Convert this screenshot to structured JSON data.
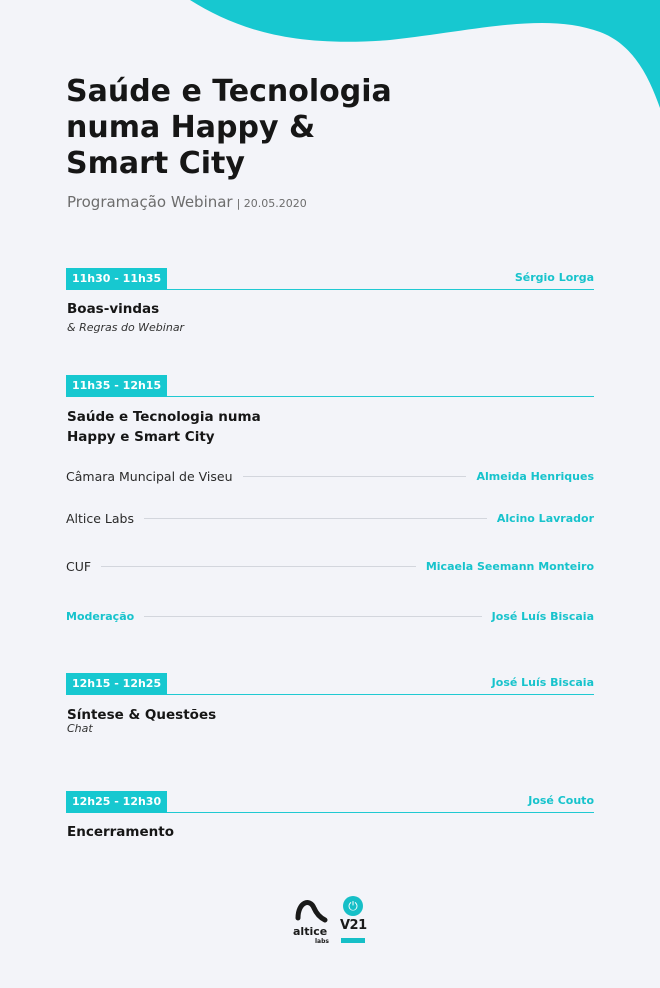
{
  "header": {
    "title_lines": [
      "Saúde e Tecnologia",
      "numa Happy &",
      "Smart City"
    ],
    "subtitle": "Programação Webinar",
    "date": "| 20.05.2020"
  },
  "sessions": [
    {
      "time": "11h30 - 11h35",
      "speaker": "Sérgio Lorga",
      "title_lines": [
        "Boas-vindas"
      ],
      "subtitle": "& Regras do Webinar"
    },
    {
      "time": "11h35 - 12h15",
      "title_lines": [
        "Saúde e Tecnologia numa",
        "Happy e Smart City"
      ],
      "participants": [
        {
          "org": "Câmara Muncipal de Viseu",
          "name": "Almeida Henriques"
        },
        {
          "org": "Altice Labs",
          "name": "Alcino Lavrador"
        },
        {
          "org": "CUF",
          "name": "Micaela Seemann Monteiro"
        },
        {
          "org": "Moderação",
          "name": "José Luís Biscaia"
        }
      ]
    },
    {
      "time": "12h15 - 12h25",
      "speaker": "José Luís Biscaia",
      "title_lines": [
        "Síntese & Questões"
      ],
      "subtitle": "Chat"
    },
    {
      "time": "12h25 - 12h30",
      "speaker": "José Couto",
      "title_lines": [
        "Encerramento"
      ]
    }
  ],
  "logos": {
    "altice_main": "altice",
    "altice_sub": "labs",
    "v21_text": "V21",
    "v21_icon": "power-icon"
  },
  "colors": {
    "accent": "#17c8d0",
    "background": "#f3f4f9"
  }
}
